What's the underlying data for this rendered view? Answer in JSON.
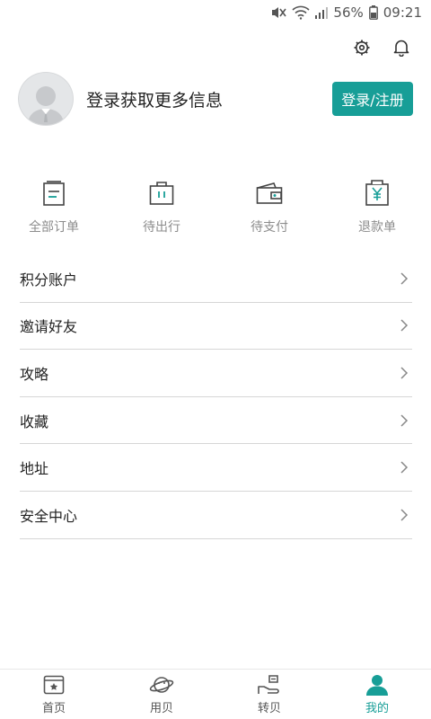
{
  "status_bar": {
    "battery": "56%",
    "time": "09:21"
  },
  "header": {
    "settings_icon": "gear-icon",
    "notifications_icon": "bell-icon"
  },
  "profile": {
    "prompt": "登录获取更多信息",
    "login_button": "登录/注册"
  },
  "orders": [
    {
      "label": "全部订单",
      "icon": "document-list-icon"
    },
    {
      "label": "待出行",
      "icon": "suitcase-icon"
    },
    {
      "label": "待支付",
      "icon": "wallet-icon"
    },
    {
      "label": "退款单",
      "icon": "refund-yen-icon"
    }
  ],
  "menu": [
    {
      "label": "积分账户"
    },
    {
      "label": "邀请好友"
    },
    {
      "label": "攻略"
    },
    {
      "label": "收藏"
    },
    {
      "label": "地址"
    },
    {
      "label": "安全中心"
    }
  ],
  "bottom_nav": [
    {
      "label": "首页",
      "icon": "home-star-icon",
      "active": false
    },
    {
      "label": "用贝",
      "icon": "planet-icon",
      "active": false
    },
    {
      "label": "转贝",
      "icon": "transfer-hand-icon",
      "active": false
    },
    {
      "label": "我的",
      "icon": "person-icon",
      "active": true
    }
  ],
  "colors": {
    "accent": "#179e97",
    "text": "#222222",
    "muted": "#8c8c8c",
    "divider": "#d6d6d6"
  }
}
